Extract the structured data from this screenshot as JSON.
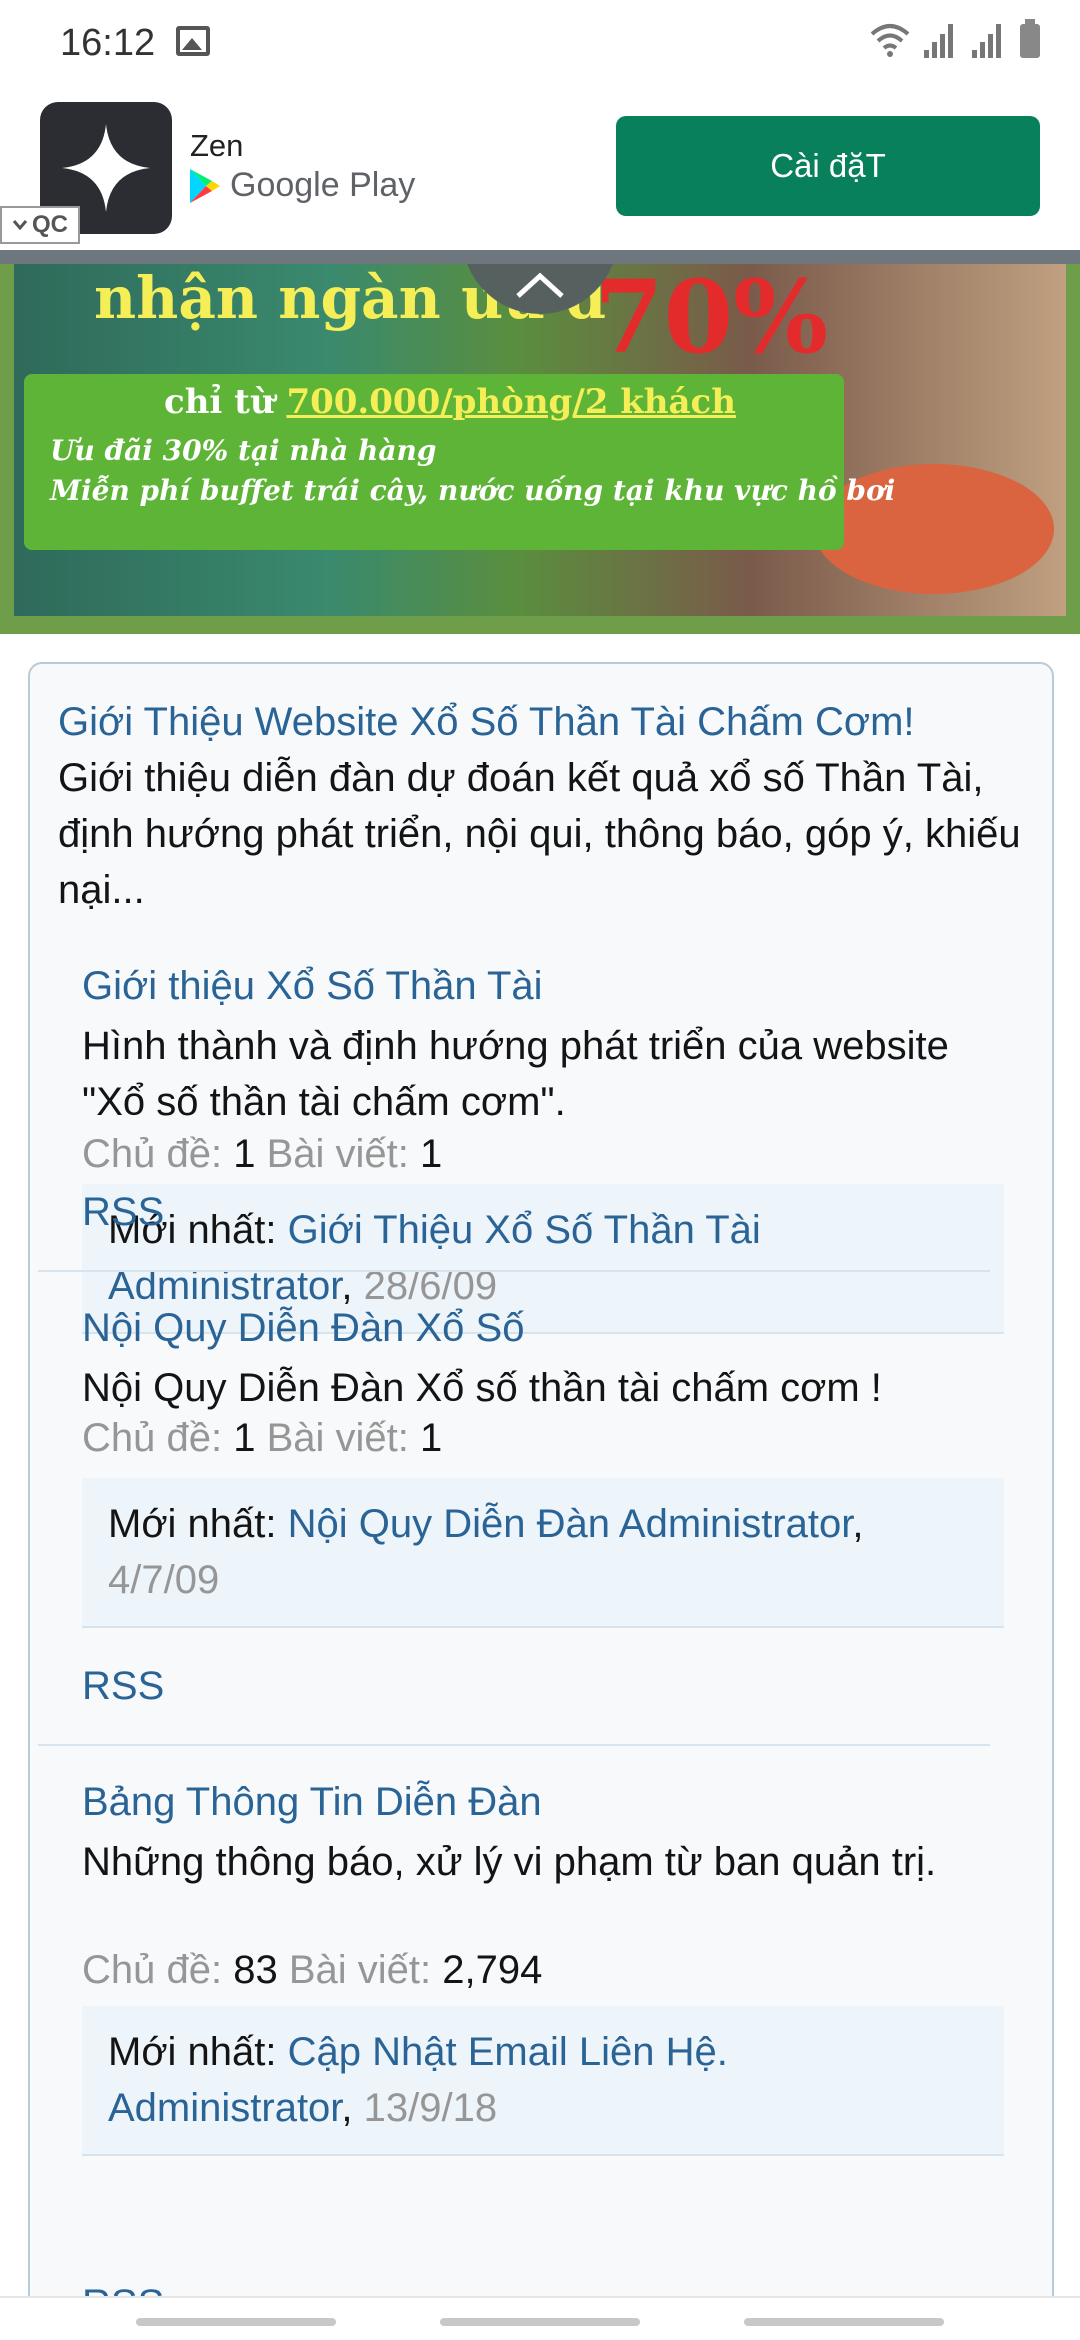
{
  "status": {
    "time": "16:12",
    "icons": [
      "gallery-icon",
      "wifi-icon",
      "signal-icon",
      "signal-icon",
      "battery-icon"
    ]
  },
  "ad": {
    "app_name": "Zen",
    "store_label": "Google Play",
    "install_label": "Cài đặT",
    "badge": "QC",
    "install_color": "#07805b"
  },
  "banner": {
    "headline": "nhận ngàn ưu đ",
    "percent": "70%",
    "price_prefix": "chỉ từ",
    "price": "700.000/phòng/2 khách",
    "line1": "Ưu đãi 30% tại nhà hàng",
    "line2": "Miễn phí buffet trái cây, nước uống tại khu vực hồ bơi"
  },
  "forum": {
    "title": "Giới Thiệu Website Xổ Số Thần Tài Chấm Cơm!",
    "description": "Giới thiệu diễn đàn dự đoán kết quả xổ số Thần Tài, định hướng phát triển, nội qui, thông báo, góp ý, khiếu nại...",
    "labels": {
      "topics": "Chủ đề:",
      "posts": "Bài viết:",
      "latest": "Mới nhất:",
      "rss": "RSS"
    },
    "nodes": [
      {
        "title": "Giới thiệu Xổ Số Thần Tài",
        "description": "Hình thành và định hướng phát triển của website \"Xổ số thần tài chấm cơm\".",
        "topics": "1",
        "posts": "1",
        "latest_thread": "Giới Thiệu Xổ Số Thần Tài",
        "latest_user": "Administrator",
        "latest_date": "28/6/09"
      },
      {
        "title": "Nội Quy Diễn Đàn Xổ Số",
        "description": "Nội Quy Diễn Đàn Xổ số thần tài chấm cơm !",
        "topics": "1",
        "posts": "1",
        "latest_thread": "Nội Quy Diễn Đàn",
        "latest_user": "Administrator",
        "latest_date": "4/7/09"
      },
      {
        "title": "Bảng Thông Tin Diễn Đàn",
        "description": "Những thông báo, xử lý vi phạm từ ban quản trị.",
        "topics": "83",
        "posts": "2,794",
        "latest_thread": "Cập Nhật Email Liên Hệ.",
        "latest_user": "Administrator",
        "latest_date": "13/9/18"
      }
    ]
  },
  "colors": {
    "link": "#2a6496",
    "muted": "#969696",
    "card_border": "#b7cbd8"
  }
}
